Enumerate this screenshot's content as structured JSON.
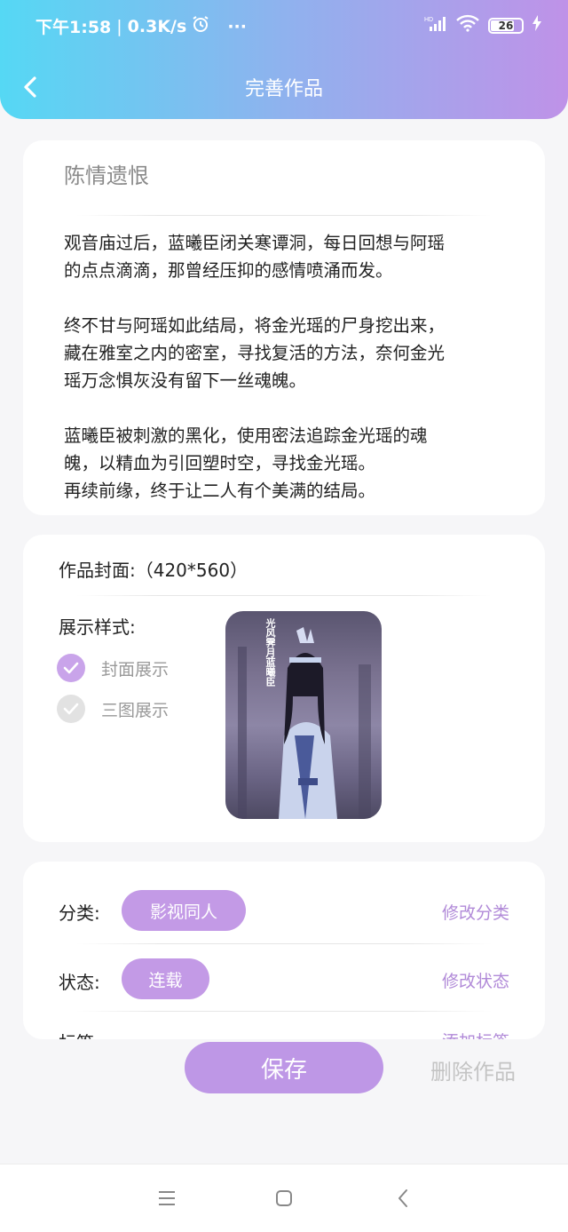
{
  "status_bar": {
    "time": "下午1:58",
    "separator": "|",
    "speed": "0.3K/s",
    "more": "···",
    "battery": "26"
  },
  "header": {
    "title": "完善作品"
  },
  "work": {
    "title": "陈情遗恨",
    "paragraphs": [
      "观音庙过后，蓝曦臣闭关寒谭洞，每日回想与阿瑶\n的点点滴滴，那曾经压抑的感情喷涌而发。",
      "终不甘与阿瑶如此结局，将金光瑶的尸身挖出来，\n藏在雅室之内的密室，寻找复活的方法，奈何金光\n瑶万念惧灰没有留下一丝魂魄。",
      "蓝曦臣被刺激的黑化，使用密法追踪金光瑶的魂\n魄，以精血为引回塑时空，寻找金光瑶。\n再续前缘，终于让二人有个美满的结局。"
    ]
  },
  "cover": {
    "label": "作品封面:（420*560）",
    "style_label": "展示样式:",
    "options": [
      {
        "label": "封面展示",
        "checked": true
      },
      {
        "label": "三图展示",
        "checked": false
      }
    ],
    "image_caption": "光风霁月蓝曦臣"
  },
  "meta": {
    "category_label": "分类:",
    "category_value": "影视同人",
    "category_action": "修改分类",
    "status_label": "状态:",
    "status_value": "连载",
    "status_action": "修改状态",
    "tags_label": "标签:",
    "tags_action": "添加标签"
  },
  "actions": {
    "save": "保存",
    "delete": "删除作品"
  },
  "colors": {
    "accent": "#c39ae6",
    "link": "#b18ad8",
    "header_start": "#55d8f4",
    "header_end": "#bf92e8"
  }
}
